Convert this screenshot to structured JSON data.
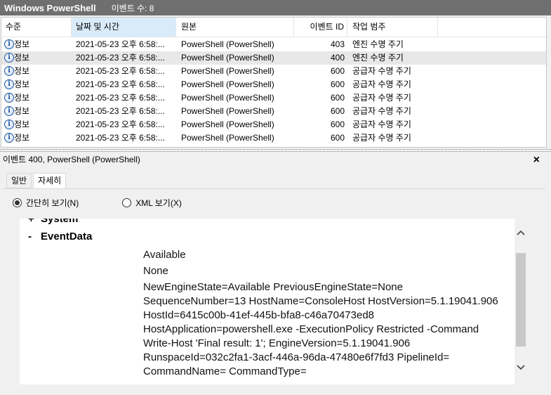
{
  "window": {
    "title": "Windows PowerShell",
    "event_count": "이벤트 수: 8"
  },
  "columns": [
    "수준",
    "날짜 및 시간",
    "원본",
    "이벤트 ID",
    "작업 범주"
  ],
  "rows": [
    {
      "level": "정보",
      "datetime": "2021-05-23 오후 6:58:...",
      "source": "PowerShell (PowerShell)",
      "event_id": "403",
      "category": "엔진 수명 주기"
    },
    {
      "level": "정보",
      "datetime": "2021-05-23 오후 6:58:...",
      "source": "PowerShell (PowerShell)",
      "event_id": "400",
      "category": "엔진 수명 주기"
    },
    {
      "level": "정보",
      "datetime": "2021-05-23 오후 6:58:...",
      "source": "PowerShell (PowerShell)",
      "event_id": "600",
      "category": "공급자 수명 주기"
    },
    {
      "level": "정보",
      "datetime": "2021-05-23 오후 6:58:...",
      "source": "PowerShell (PowerShell)",
      "event_id": "600",
      "category": "공급자 수명 주기"
    },
    {
      "level": "정보",
      "datetime": "2021-05-23 오후 6:58:...",
      "source": "PowerShell (PowerShell)",
      "event_id": "600",
      "category": "공급자 수명 주기"
    },
    {
      "level": "정보",
      "datetime": "2021-05-23 오후 6:58:...",
      "source": "PowerShell (PowerShell)",
      "event_id": "600",
      "category": "공급자 수명 주기"
    },
    {
      "level": "정보",
      "datetime": "2021-05-23 오후 6:58:...",
      "source": "PowerShell (PowerShell)",
      "event_id": "600",
      "category": "공급자 수명 주기"
    },
    {
      "level": "정보",
      "datetime": "2021-05-23 오후 6:58:...",
      "source": "PowerShell (PowerShell)",
      "event_id": "600",
      "category": "공급자 수명 주기"
    }
  ],
  "details": {
    "title": "이벤트 400, PowerShell (PowerShell)",
    "close": "×",
    "tabs": [
      "일반",
      "자세히"
    ],
    "view_modes": {
      "friendly": "간단히 보기(N)",
      "xml": "XML 보기(X)"
    },
    "tree": {
      "system": {
        "toggle": "+",
        "label": "System"
      },
      "eventdata": {
        "toggle": "-",
        "label": "EventData"
      }
    },
    "event_data": [
      "Available",
      "None",
      "NewEngineState=Available PreviousEngineState=None SequenceNumber=13 HostName=ConsoleHost HostVersion=5.1.19041.906 HostId=6415c00b-41ef-445b-bfa8-c46a70473ed8 HostApplication=powershell.exe -ExecutionPolicy Restricted -Command Write-Host 'Final result: 1'; EngineVersion=5.1.19041.906 RunspaceId=032c2fa1-3acf-446a-96da-47480e6f7fd3 PipelineId= CommandName= CommandType="
    ]
  },
  "icons": {
    "level": "info-icon",
    "scroll_up": "chevron-up-icon",
    "scroll_down": "chevron-down-icon"
  }
}
